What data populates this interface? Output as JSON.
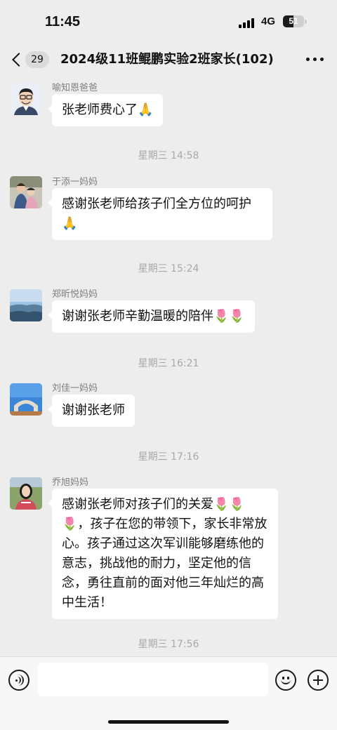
{
  "status": {
    "time": "11:45",
    "network": "4G",
    "battery": "51",
    "battery_level": 0.51
  },
  "nav": {
    "unread": "29",
    "title": "2024级11班鲲鹏实验2班家长(102)"
  },
  "messages": [
    {
      "sender": "喻知恩爸爸",
      "text": "张老师费心了🙏",
      "avatar": "avatar-cartoon-man"
    },
    {
      "timestamp": "星期三 14:58"
    },
    {
      "sender": "于添一妈妈",
      "text": "感谢张老师给孩子们全方位的呵护🙏",
      "avatar": "avatar-mother-child"
    },
    {
      "timestamp": "星期三 15:24"
    },
    {
      "sender": "郑昕悦妈妈",
      "text": "谢谢张老师辛勤温暖的陪伴🌷🌷",
      "avatar": "avatar-landscape-sky"
    },
    {
      "timestamp": "星期三 16:21"
    },
    {
      "sender": "刘佳一妈妈",
      "text": "谢谢张老师",
      "avatar": "avatar-blue-sky-arch"
    },
    {
      "timestamp": "星期三 17:16"
    },
    {
      "sender": "乔旭妈妈",
      "text": "感谢张老师对孩子们的关爱🌷🌷🌷，孩子在您的带领下，家长非常放心。孩子通过这次军训能够磨练他的意志，挑战他的耐力，坚定他的信念，勇往直前的面对他三年灿烂的高中生活！",
      "avatar": "avatar-woman-portrait"
    },
    {
      "timestamp": "星期三 17:56"
    }
  ],
  "input": {
    "placeholder": ""
  },
  "icons": {
    "voice": "voice-icon",
    "emoji": "emoji-icon",
    "plus": "plus-icon",
    "back": "back-chevron-icon",
    "more": "more-dots-icon"
  }
}
